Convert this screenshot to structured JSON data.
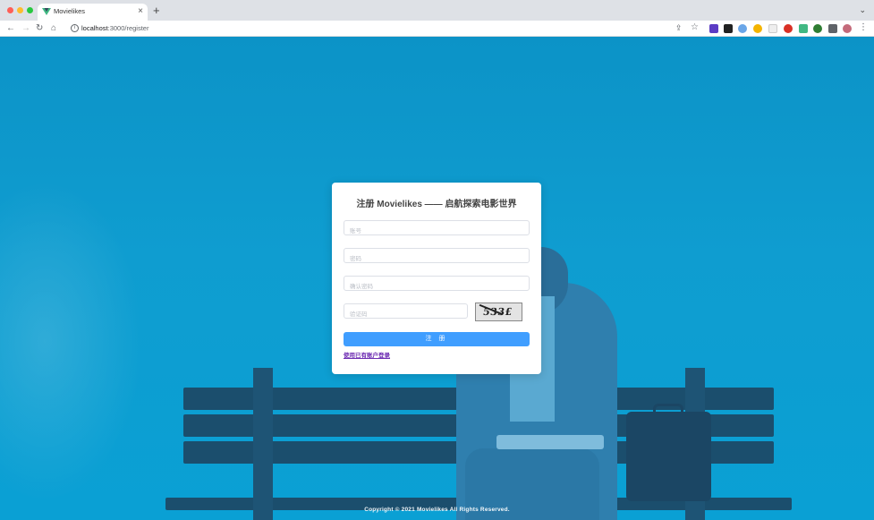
{
  "browser": {
    "tab_title": "Movielikes",
    "tab_close": "×",
    "new_tab": "+",
    "tab_menu": "⌄",
    "url_host": "localhost",
    "url_path": ":3000/register",
    "nav_back": "←",
    "nav_forward": "→",
    "nav_reload": "↻",
    "nav_home": "⌂",
    "menu": "⋮"
  },
  "register": {
    "title": "注册 Movielikes —— 启航探索电影世界",
    "account_placeholder": "账号",
    "password_placeholder": "密码",
    "confirm_placeholder": "确认密码",
    "captcha_placeholder": "验证码",
    "captcha_text": "533£",
    "submit_label": "注 册",
    "login_link": "使用已有账户登录"
  },
  "footer": {
    "copyright": "Copyright © 2021 Movielikes All Rights Reserved."
  },
  "colors": {
    "primary": "#409eff",
    "background": "#0f9dd0",
    "link": "#6c2bb2"
  }
}
